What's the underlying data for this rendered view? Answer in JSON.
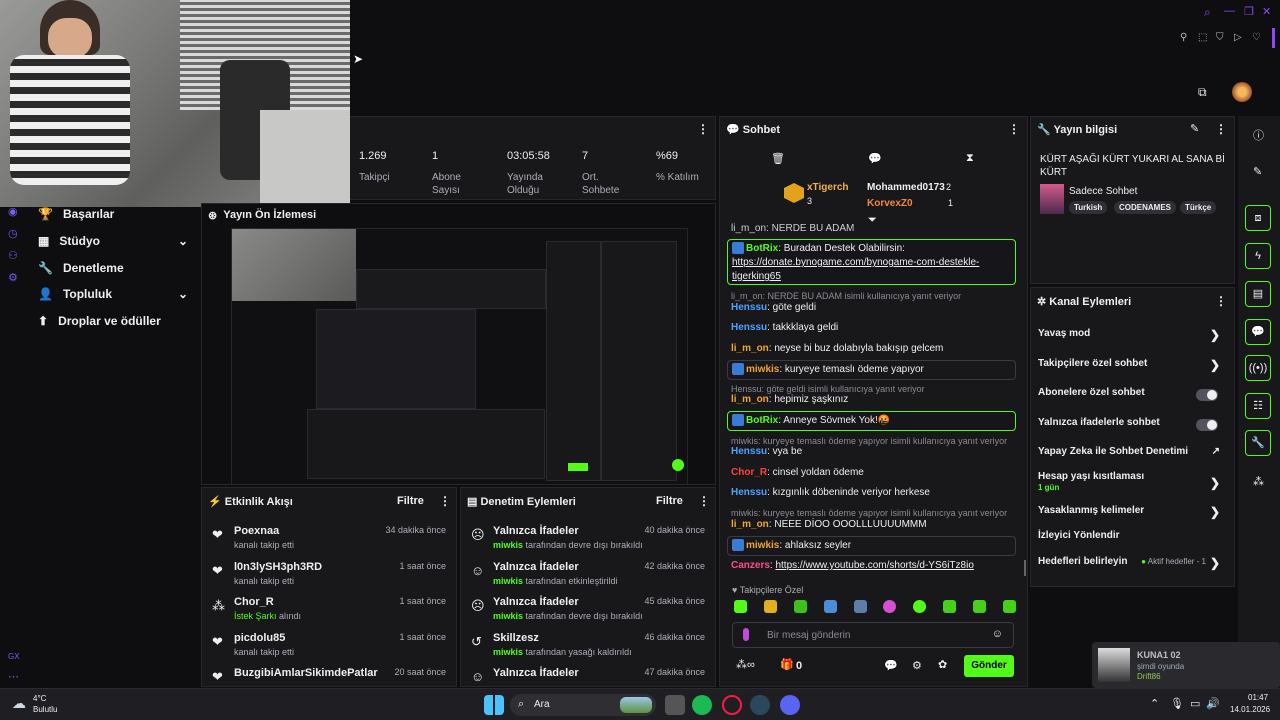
{
  "stats": [
    {
      "value": "1.269",
      "label": "Takipçi"
    },
    {
      "value": "1",
      "label": "Abone Sayısı"
    },
    {
      "value": "03:05:58",
      "label": "Yayında Olduğu"
    },
    {
      "value": "7",
      "label": "Ort. Sohbete"
    },
    {
      "value": "%69",
      "label": "% Katılım"
    }
  ],
  "nav": [
    {
      "label": "Başarılar",
      "icon": "trophy-icon"
    },
    {
      "label": "Stüdyo",
      "icon": "studio-icon",
      "chevron": true
    },
    {
      "label": "Denetleme",
      "icon": "wrench-icon"
    },
    {
      "label": "Topluluk",
      "icon": "community-icon",
      "chevron": true
    },
    {
      "label": "Droplar ve ödüller",
      "icon": "drops-icon"
    }
  ],
  "preview": {
    "title": "Yayın Ön İzlemesi"
  },
  "activity": {
    "title": "Etkinlik Akışı",
    "filter": "Filtre",
    "items": [
      {
        "name": "Poexnaa",
        "sub": "kanalı takip etti",
        "time": "34 dakika önce",
        "icon": "heart-icon"
      },
      {
        "name": "l0n3lySH3ph3RD",
        "sub": "kanalı takip etti",
        "time": "1 saat önce",
        "icon": "heart-icon"
      },
      {
        "name": "Chor_R",
        "sub": "İstek Şarkı alındı",
        "subg": "İstek Şarkı",
        "subr": " alındı",
        "time": "1 saat önce",
        "icon": "reward-icon"
      },
      {
        "name": "picdolu85",
        "sub": "kanalı takip etti",
        "time": "1 saat önce",
        "icon": "heart-icon"
      },
      {
        "name": "BuzgibiAmlarSikimdePatlar",
        "sub": "",
        "time": "20 saat önce",
        "icon": "heart-icon"
      }
    ]
  },
  "moderation": {
    "title": "Denetim Eylemleri",
    "filter": "Filtre",
    "items": [
      {
        "name": "Yalnızca İfadeler",
        "user": "miwkis",
        "rest": " tarafından devre dışı bırakıldı",
        "time": "40 dakika önce"
      },
      {
        "name": "Yalnızca İfadeler",
        "user": "miwkis",
        "rest": " tarafından etkinleştirildi",
        "time": "42 dakika önce"
      },
      {
        "name": "Yalnızca İfadeler",
        "user": "miwkis",
        "rest": " tarafından devre dışı bırakıldı",
        "time": "45 dakika önce"
      },
      {
        "name": "Skillzesz",
        "user": "miwkis",
        "rest": " tarafından yasağı kaldırıldı",
        "time": "46 dakika önce"
      },
      {
        "name": "Yalnızca İfadeler",
        "user": "",
        "rest": "",
        "time": "47 dakika önce"
      }
    ]
  },
  "chat": {
    "title": "Sohbet",
    "top": [
      {
        "name": "xTigerch",
        "count": "3"
      },
      {
        "name": "Mohammed0173",
        "count": "2"
      },
      {
        "name": "KorvexZ0",
        "count": "1"
      }
    ],
    "cut": "li_m_on: NERDE BU ADAM",
    "botrix1_user": "BotRix",
    "botrix1_text": ": Buradan Destek Olabilirsin:",
    "botrix1_link": "https://donate.bynogame.com/bynogame-com-destekle-tigerking65",
    "reply1": "li_m_on: NERDE BU ADAM isimli kullanıcıya yanıt veriyor",
    "m1_user": "Henssu",
    "m1_text": ": göte geldi",
    "m2_user": "Henssu",
    "m2_text": ": takkklaya geldi",
    "m3_user": "li_m_on",
    "m3_text": ": neyse bi buz dolabıyla bakışıp gelcem",
    "m4_user": "miwkis",
    "m4_text": ": kuryeye temaslı ödeme yapıyor",
    "reply2": "Henssu: göte geldi isimli kullanıcıya yanıt veriyor",
    "m5_user": "li_m_on",
    "m5_text": ": hepimiz şaşkınız",
    "m6_user": "BotRix",
    "m6_text": ": Anneye Sövmek Yok!🤬",
    "reply3": "miwkis: kuryeye temaslı ödeme yapıyor isimli kullanıcıya yanıt veriyor",
    "m7_user": "Henssu",
    "m7_text": ": vya be",
    "m8_user": "Chor_R",
    "m8_text": ": cinsel yoldan ödeme",
    "m9_user": "Henssu",
    "m9_text": ": kızgınlık döbeninde veriyor herkese",
    "reply4": "miwkis: kuryeye temaslı ödeme yapıyor isimli kullanıcıya yanıt veriyor",
    "m10_user": "li_m_on",
    "m10_text": ": NEEE DİOO OOOLLLUUUUMMM",
    "m11_user": "miwkis",
    "m11_text": ": ahlaksız seyler",
    "m12_user": "Canzers",
    "m12_text": ": ",
    "m12_link": "https://www.youtube.com/shorts/d-YS6iTz8io",
    "emote_label": "Takipçilere Özel",
    "placeholder": "Bir mesaj gönderin",
    "points": "0",
    "send": "Gönder"
  },
  "streaminfo": {
    "title": "Yayın bilgisi",
    "stream_title": "KÜRT AŞAĞI KÜRT YUKARI AL SANA Bİ KÜRT",
    "category": "Sadece Sohbet",
    "tags": [
      "Turkish",
      "CODENAMES",
      "Türkçe"
    ]
  },
  "channel": {
    "title": "Kanal Eylemleri",
    "items": [
      {
        "label": "Yavaş mod",
        "type": "chev"
      },
      {
        "label": "Takipçilere özel sohbet",
        "type": "chev"
      },
      {
        "label": "Abonelere özel sohbet",
        "type": "toggle"
      },
      {
        "label": "Yalnızca ifadelerle sohbet",
        "type": "toggle"
      },
      {
        "label": "Yapay Zeka ile Sohbet Denetimi",
        "type": "ext"
      },
      {
        "label": "Hesap yaşı kısıtlaması",
        "sub": "1 gün",
        "type": "chev"
      },
      {
        "label": "Yasaklanmış kelimeler",
        "type": "chev"
      },
      {
        "label": "İzleyici Yönlendir",
        "type": "none"
      },
      {
        "label": "Hedefleri belirleyin",
        "extra": "Aktif hedefler - 1",
        "type": "chev"
      }
    ]
  },
  "notification": {
    "name": "KUNA1 02",
    "status": "şimdi oyunda",
    "game": "Drift86"
  },
  "taskbar": {
    "temp": "4°C",
    "weather": "Bulutlu",
    "search": "Ara",
    "time": "01:47",
    "date": "14.01.2026"
  },
  "colors": {
    "accent": "#53fc18",
    "bg": "#0e0e10",
    "panel": "#18181b"
  }
}
